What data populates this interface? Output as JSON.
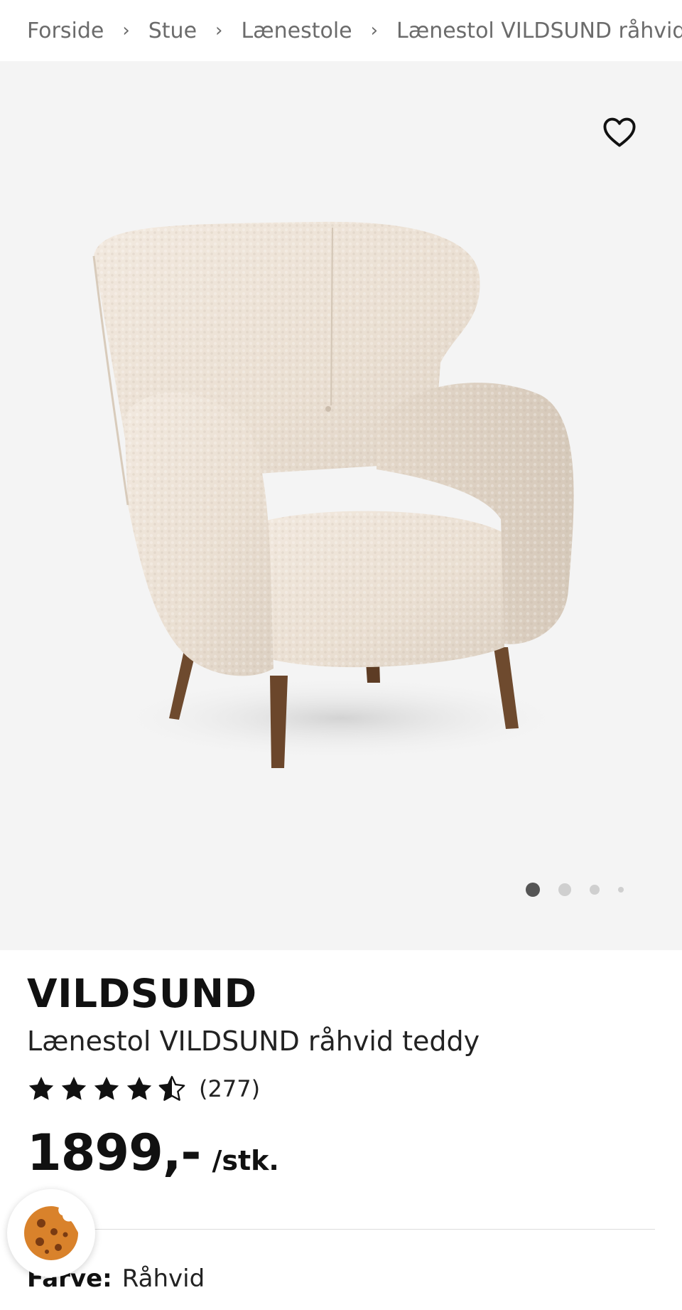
{
  "breadcrumb": {
    "items": [
      "Forside",
      "Stue",
      "Lænestole"
    ],
    "current": "Lænestol VILDSUND råhvid te",
    "separator": "›"
  },
  "gallery": {
    "image_alt": "Lænestol VILDSUND råhvid teddy",
    "favorite_icon": "heart-outline-icon",
    "background": "#f4f4f4",
    "current_index": 1,
    "total_visible_dots": 4
  },
  "product": {
    "brand": "VILDSUND",
    "name": "Lænestol VILDSUND råhvid teddy",
    "rating_value": 4.5,
    "rating_max": 5,
    "review_count": "(277)",
    "price": "1899,-",
    "unit": "/stk."
  },
  "variant": {
    "color_label": "Farve:",
    "color_value": "Råhvid"
  },
  "cookie_button": {
    "icon": "cookie-icon",
    "color": "#d9822b"
  }
}
